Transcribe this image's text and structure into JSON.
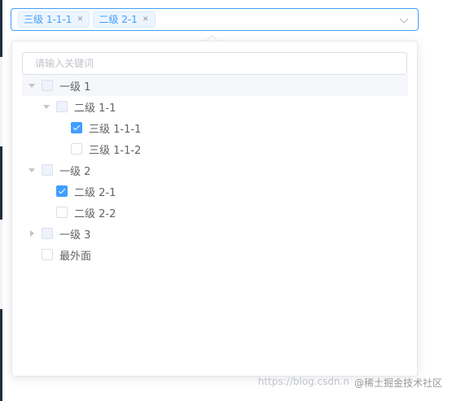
{
  "select": {
    "tags": [
      {
        "label": "三级 1-1-1"
      },
      {
        "label": "二级 2-1"
      }
    ]
  },
  "dropdown": {
    "filter_placeholder": "请输入关键词",
    "tree": [
      {
        "label": "一级 1",
        "level": 0,
        "expand": "open",
        "checkbox": "disabled",
        "hover": true
      },
      {
        "label": "二级 1-1",
        "level": 1,
        "expand": "open",
        "checkbox": "disabled"
      },
      {
        "label": "三级 1-1-1",
        "level": 2,
        "expand": "leaf",
        "checkbox": "checked"
      },
      {
        "label": "三级 1-1-2",
        "level": 2,
        "expand": "leaf",
        "checkbox": "unchecked"
      },
      {
        "label": "一级 2",
        "level": 0,
        "expand": "open",
        "checkbox": "disabled"
      },
      {
        "label": "二级 2-1",
        "level": 1,
        "expand": "leaf",
        "checkbox": "checked"
      },
      {
        "label": "二级 2-2",
        "level": 1,
        "expand": "leaf",
        "checkbox": "unchecked"
      },
      {
        "label": "一级 3",
        "level": 0,
        "expand": "closed",
        "checkbox": "disabled"
      },
      {
        "label": "最外面",
        "level": 0,
        "expand": "leaf",
        "checkbox": "unchecked"
      }
    ]
  },
  "watermark": {
    "text1": "https://blog.csdn.n",
    "text2": "@稀土掘金技术社区"
  },
  "colors": {
    "accent": "#409eff",
    "border": "#dcdfe6",
    "text": "#606266"
  },
  "icons": {
    "tag_close": "close-icon",
    "select_arrow": "chevron-down-icon",
    "tree_expand": "caret-icon"
  }
}
